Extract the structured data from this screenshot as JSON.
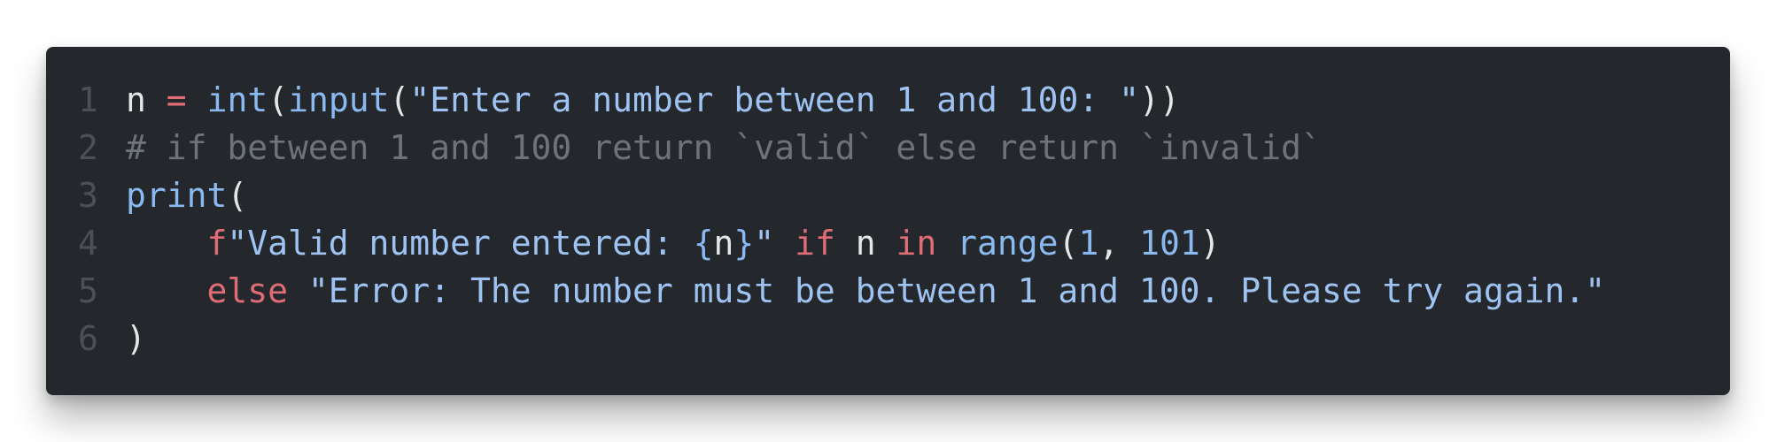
{
  "editor": {
    "line_numbers": [
      "1",
      "2",
      "3",
      "4",
      "5",
      "6"
    ],
    "line1": {
      "var": "n",
      "sp1": " ",
      "op": "=",
      "sp2": " ",
      "fn_int": "int",
      "p1": "(",
      "fn_input": "input",
      "p2": "(",
      "str": "\"Enter a number between 1 and 100: \"",
      "p3": "))"
    },
    "line2": {
      "comment": "# if between 1 and 100 return `valid` else return `invalid`"
    },
    "line3": {
      "fn_print": "print",
      "p1": "("
    },
    "line4": {
      "indent": "    ",
      "fprefix": "f",
      "str_a": "\"Valid number entered: ",
      "brace_open": "{",
      "var": "n",
      "brace_close": "}",
      "str_b": "\"",
      "sp1": " ",
      "kw_if": "if",
      "sp2": " ",
      "var2": "n",
      "sp3": " ",
      "kw_in": "in",
      "sp4": " ",
      "fn_range": "range",
      "p1": "(",
      "num1": "1",
      "comma": ", ",
      "num2": "101",
      "p2": ")"
    },
    "line5": {
      "indent": "    ",
      "kw_else": "else",
      "sp": " ",
      "str": "\"Error: The number must be between 1 and 100. Please try again.\""
    },
    "line6": {
      "p1": ")"
    }
  },
  "colors": {
    "background": "#24282d",
    "keyword": "#e06c75",
    "function": "#8ab9f0",
    "string": "#9ec3f2",
    "comment": "#6e737b",
    "line_number": "#4b5058",
    "text": "#e6e6e6"
  }
}
